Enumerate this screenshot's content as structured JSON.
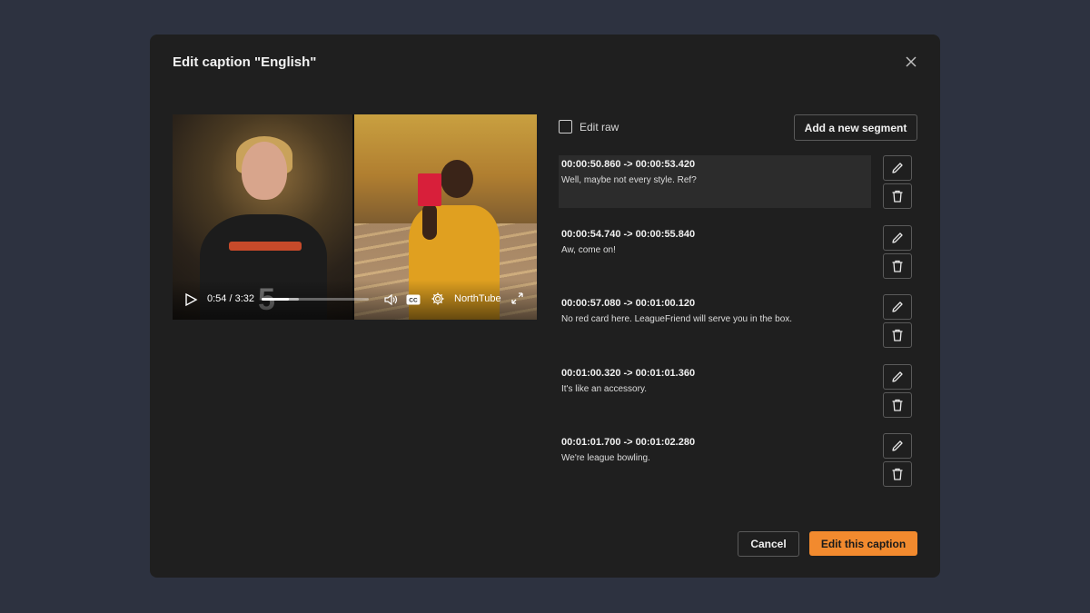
{
  "dialog": {
    "title": "Edit caption \"English\""
  },
  "player": {
    "time": "0:54 / 3:32",
    "progress": 0.25,
    "buffered": 0.35,
    "brand": "NorthTube",
    "jersey_number": "5",
    "icons": [
      "play-icon",
      "volume-icon",
      "closed-captions-icon",
      "settings-gear-icon",
      "fullscreen-icon"
    ]
  },
  "toolbar": {
    "edit_raw_label": "Edit raw",
    "edit_raw_checked": false,
    "add_segment_label": "Add a new segment"
  },
  "segments": [
    {
      "time": "00:00:50.860 -> 00:00:53.420",
      "text": "Well, maybe not every style. Ref?",
      "active": true
    },
    {
      "time": "00:00:54.740 -> 00:00:55.840",
      "text": "Aw, come on!",
      "active": false
    },
    {
      "time": "00:00:57.080 -> 00:01:00.120",
      "text": "No red card here. LeagueFriend will serve you in the box.",
      "active": false
    },
    {
      "time": "00:01:00.320 -> 00:01:01.360",
      "text": "It's like an accessory.",
      "active": false
    },
    {
      "time": "00:01:01.700 -> 00:01:02.280",
      "text": "We're league bowling.",
      "active": false
    }
  ],
  "footer": {
    "cancel_label": "Cancel",
    "submit_label": "Edit this caption"
  },
  "colors": {
    "backdrop": "#2d3240",
    "modal": "#1f1f1f",
    "accent": "#f28a2e"
  }
}
